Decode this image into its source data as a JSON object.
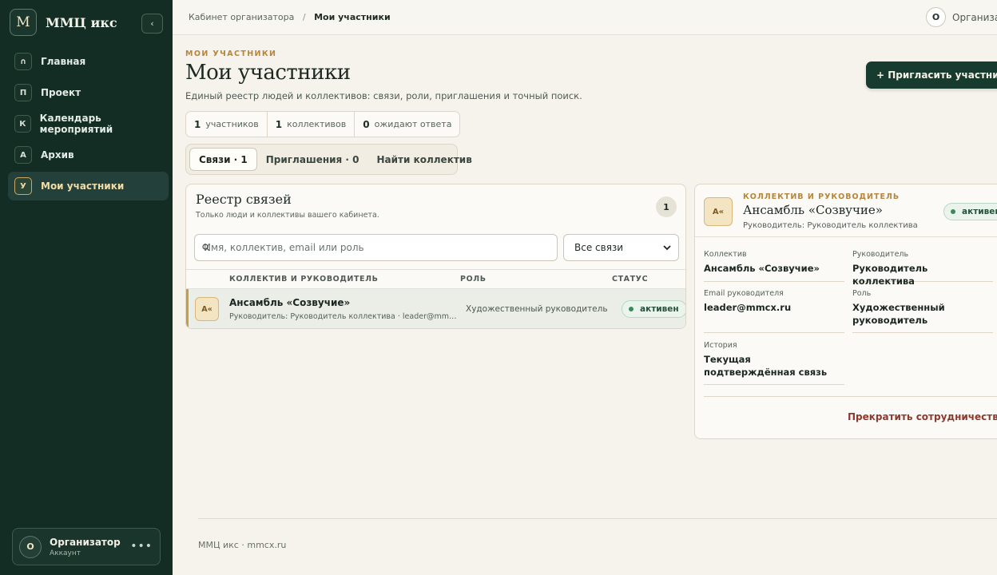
{
  "sidebar": {
    "logo_letter": "М",
    "brand_name": "ММЦ икс",
    "collapse_icon": "‹",
    "items": [
      {
        "icon": "∩",
        "label": "Главная"
      },
      {
        "icon": "П",
        "label": "Проект"
      },
      {
        "icon": "К",
        "label": "Календарь мероприятий"
      },
      {
        "icon": "А",
        "label": "Архив"
      },
      {
        "icon": "У",
        "label": "Мои участники"
      }
    ],
    "account": {
      "initial": "О",
      "name": "Организатор",
      "role": "Аккаунт",
      "more": "•••"
    }
  },
  "topbar": {
    "breadcrumb": [
      "Кабинет организатора",
      "Мои участники"
    ],
    "separator": "/",
    "user_initial": "О",
    "user_name": "Организатор"
  },
  "page": {
    "eyebrow": "МОИ УЧАСТНИКИ",
    "title": "Мои участники",
    "subtitle": "Единый реестр людей и коллективов: связи, роли, приглашения и точный поиск.",
    "invite_button": "+ Пригласить участника"
  },
  "stats": [
    {
      "value": "1",
      "label": "участников"
    },
    {
      "value": "1",
      "label": "коллективов"
    },
    {
      "value": "0",
      "label": "ожидают ответа"
    }
  ],
  "tabs": [
    {
      "label": "Связи · 1",
      "active": true
    },
    {
      "label": "Приглашения · 0",
      "active": false
    },
    {
      "label": "Найти коллектив",
      "active": false
    }
  ],
  "registry": {
    "title": "Реестр связей",
    "subtitle": "Только люди и коллективы вашего кабинета.",
    "count": "1",
    "search_placeholder": "Имя, коллектив, email или роль",
    "filter_value": "Все связи",
    "columns": [
      "КОЛЛЕКТИВ И РУКОВОДИТЕЛЬ",
      "РОЛЬ",
      "СТАТУС"
    ],
    "rows": [
      {
        "avatar": "А«",
        "name": "Ансамбль «Созвучие»",
        "meta": "Руководитель: Руководитель коллектива · leader@mmcx.ru",
        "role": "Художественный руководитель",
        "status": "активен"
      }
    ]
  },
  "detail": {
    "avatar": "А«",
    "eyebrow": "КОЛЛЕКТИВ И РУКОВОДИТЕЛЬ",
    "title": "Ансамбль «Созвучие»",
    "subtitle": "Руководитель: Руководитель коллектива",
    "status": "активен",
    "fields": [
      {
        "label": "Коллектив",
        "value": "Ансамбль «Созвучие»"
      },
      {
        "label": "Руководитель",
        "value": "Руководитель коллектива"
      },
      {
        "label": "Email руководителя",
        "value": "leader@mmcx.ru"
      },
      {
        "label": "Роль",
        "value": "Художественный руководитель"
      },
      {
        "label": "История",
        "value": "Текущая подтверждённая связь"
      }
    ],
    "terminate_button": "Прекратить сотрудничество"
  },
  "footer": {
    "text": "ММЦ икс · mmcx.ru"
  },
  "colors": {
    "sidebar_bg": "#132c24",
    "accent_gold": "#b7853c",
    "primary_button": "#183b30",
    "status_green": "#3b8a58",
    "danger": "#8b3a2e"
  }
}
